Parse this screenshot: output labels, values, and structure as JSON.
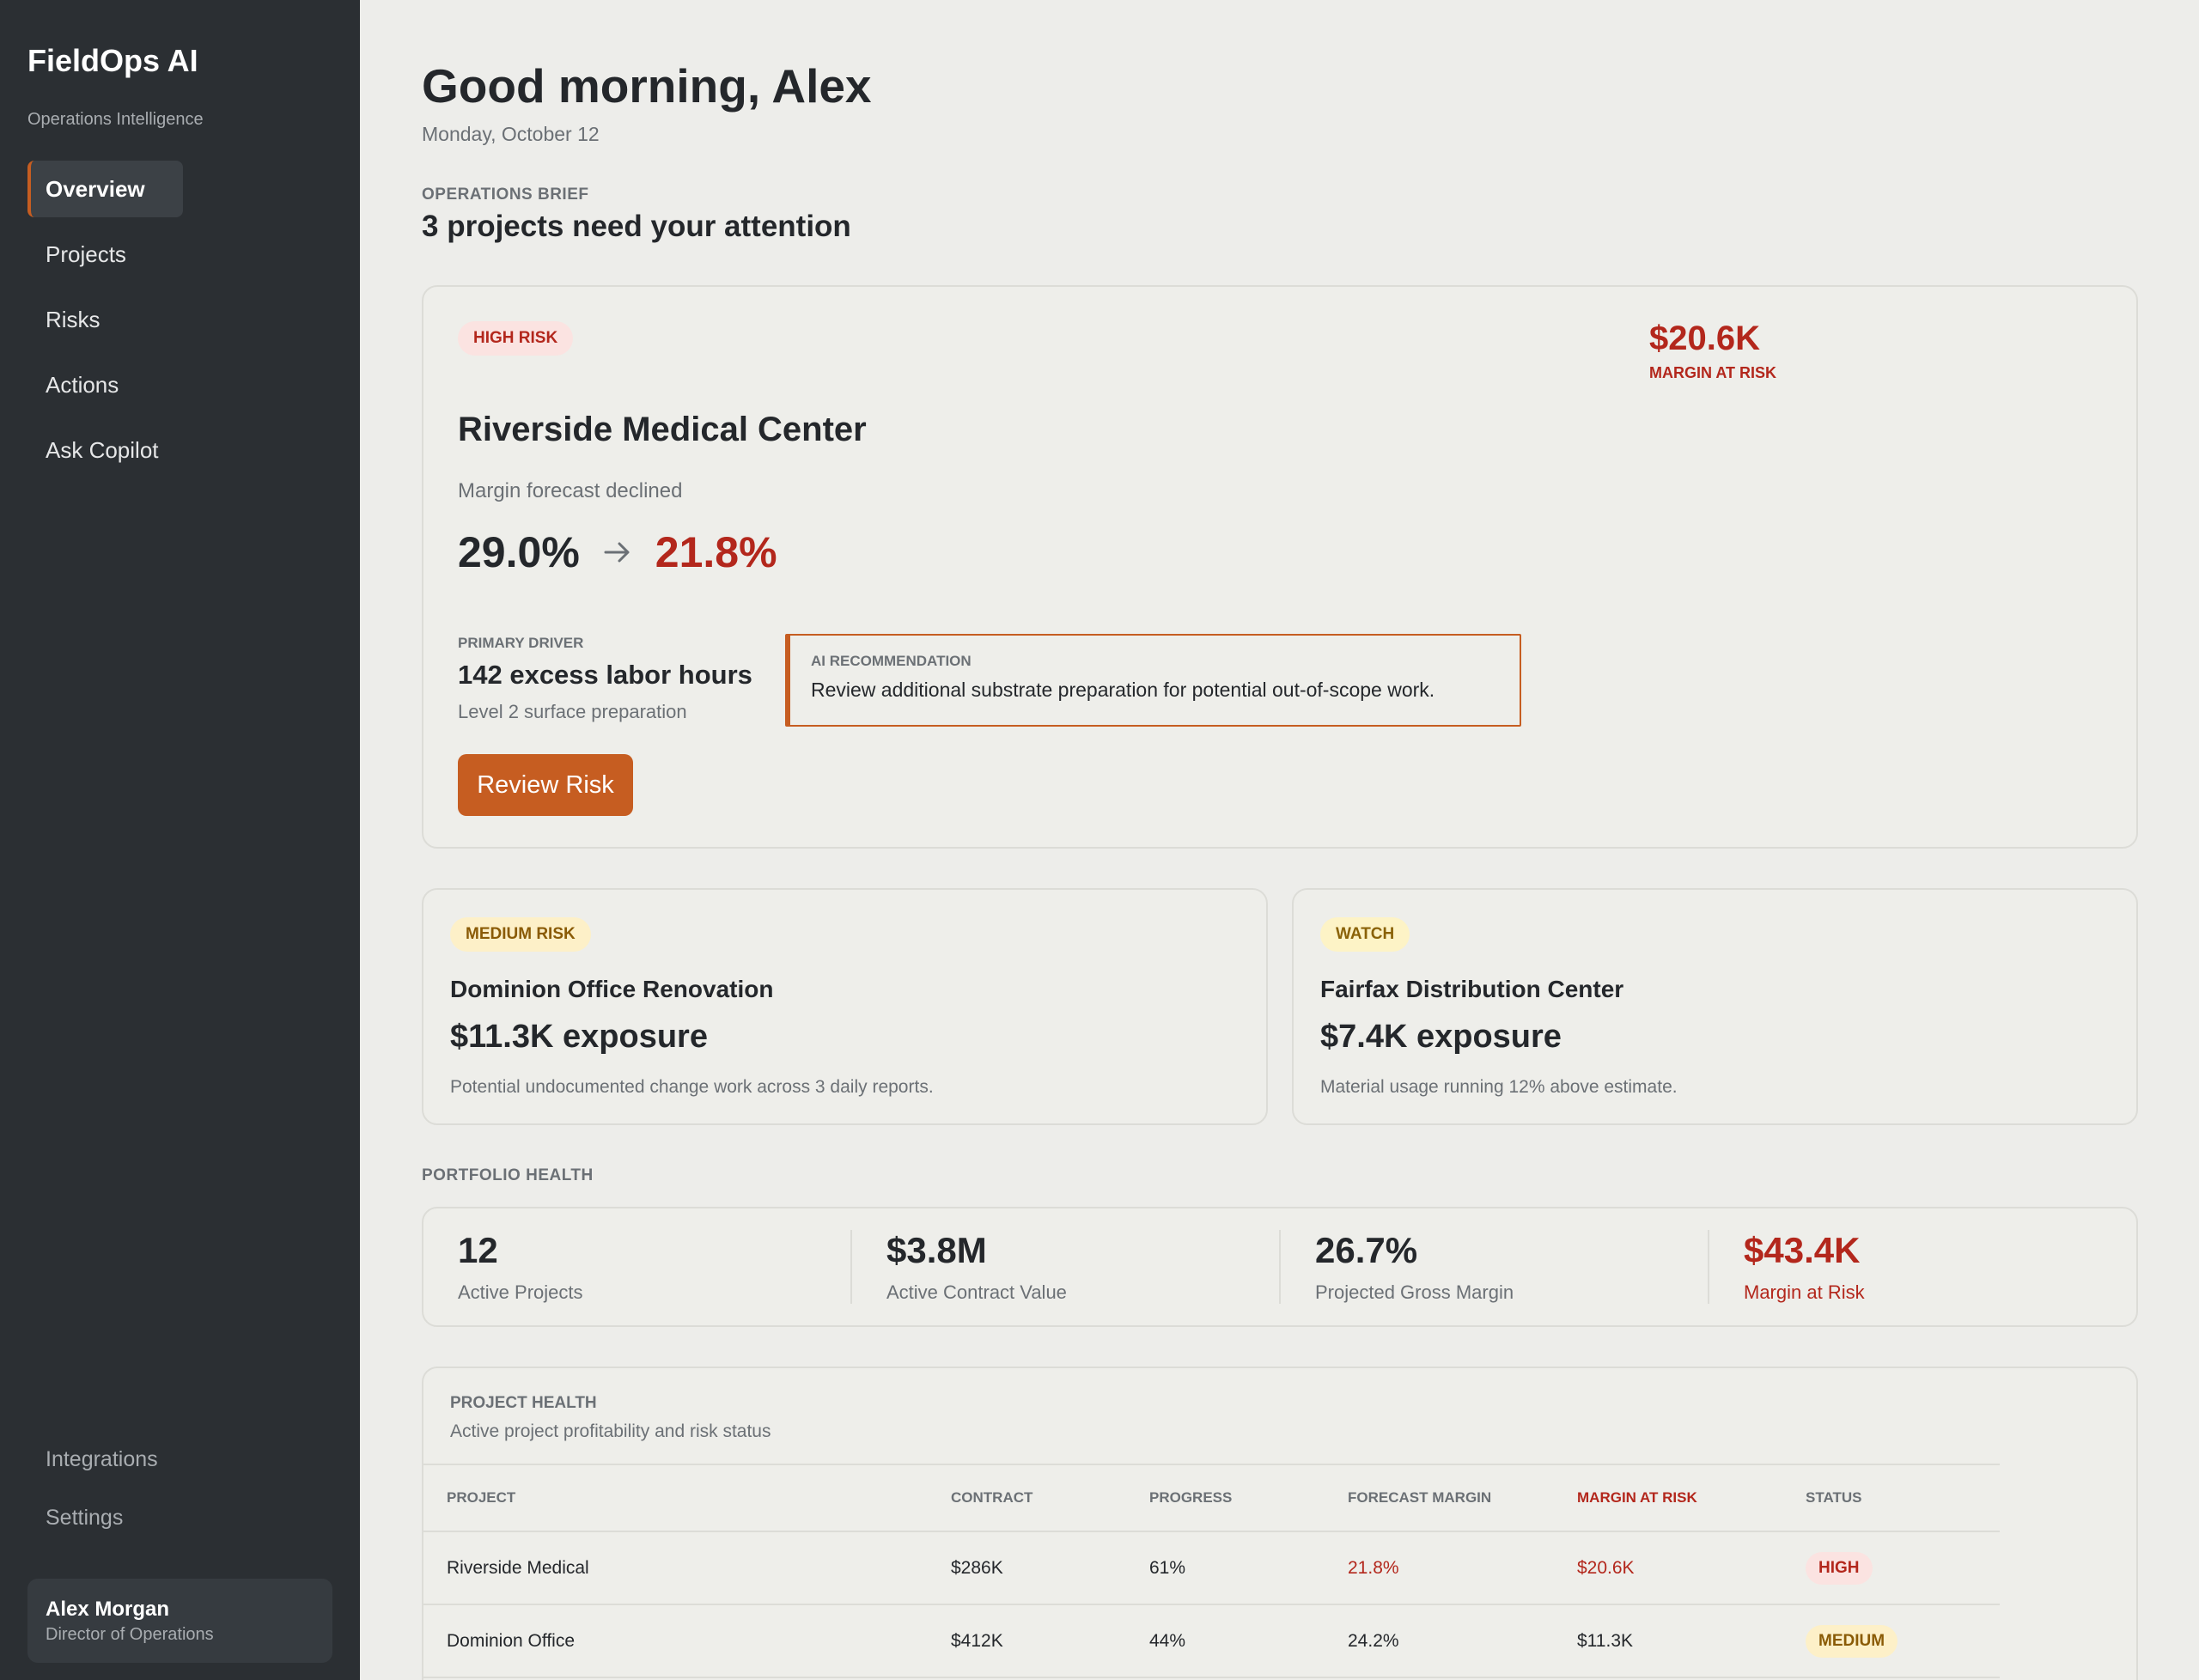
{
  "app": {
    "name": "FieldOps AI",
    "tagline": "Operations Intelligence"
  },
  "sidebar": {
    "items": [
      {
        "label": "Overview",
        "active": true
      },
      {
        "label": "Projects"
      },
      {
        "label": "Risks"
      },
      {
        "label": "Actions"
      },
      {
        "label": "Ask Copilot"
      }
    ],
    "bottom": [
      {
        "label": "Integrations"
      },
      {
        "label": "Settings"
      }
    ],
    "user": {
      "name": "Alex Morgan",
      "role": "Director of Operations"
    }
  },
  "header": {
    "greeting": "Good morning, Alex",
    "date": "Monday, October 12"
  },
  "brief": {
    "label": "OPERATIONS BRIEF",
    "title": "3 projects need your attention"
  },
  "hero": {
    "badge": "HIGH RISK",
    "amount": "$20.6K",
    "amount_label": "MARGIN AT RISK",
    "title": "Riverside Medical Center",
    "subtitle": "Margin forecast declined",
    "margin_from": "29.0%",
    "margin_to": "21.8%",
    "driver_label": "PRIMARY DRIVER",
    "driver_value": "142 excess labor hours",
    "driver_sub": "Level 2 surface preparation",
    "ai_label": "AI RECOMMENDATION",
    "ai_text": "Review additional substrate preparation for potential out-of-scope work.",
    "button": "Review Risk"
  },
  "secondary": [
    {
      "badge": "MEDIUM RISK",
      "title": "Dominion Office Renovation",
      "exposure": "$11.3K exposure",
      "description": "Potential undocumented change work across 3 daily reports."
    },
    {
      "badge": "WATCH",
      "title": "Fairfax Distribution Center",
      "exposure": "$7.4K exposure",
      "description": "Material usage running 12% above estimate."
    }
  ],
  "portfolio": {
    "label": "PORTFOLIO HEALTH",
    "kpis": [
      {
        "value": "12",
        "label": "Active Projects"
      },
      {
        "value": "$3.8M",
        "label": "Active Contract Value"
      },
      {
        "value": "26.7%",
        "label": "Projected Gross Margin"
      },
      {
        "value": "$43.4K",
        "label": "Margin at Risk"
      }
    ]
  },
  "project_health": {
    "label": "PROJECT HEALTH",
    "subtitle": "Active project profitability and risk status",
    "columns": [
      "PROJECT",
      "CONTRACT",
      "PROGRESS",
      "FORECAST MARGIN",
      "MARGIN AT RISK",
      "STATUS"
    ],
    "rows": [
      {
        "project": "Riverside Medical",
        "contract": "$286K",
        "progress": "61%",
        "forecast_margin": "21.8%",
        "margin_at_risk": "$20.6K",
        "status": "HIGH"
      },
      {
        "project": "Dominion Office",
        "contract": "$412K",
        "progress": "44%",
        "forecast_margin": "24.2%",
        "margin_at_risk": "$11.3K",
        "status": "MEDIUM"
      }
    ]
  },
  "colors": {
    "accent": "#c65d21",
    "risk": "#b3271c",
    "sidebar": "#2b2f33",
    "background": "#ededea"
  }
}
